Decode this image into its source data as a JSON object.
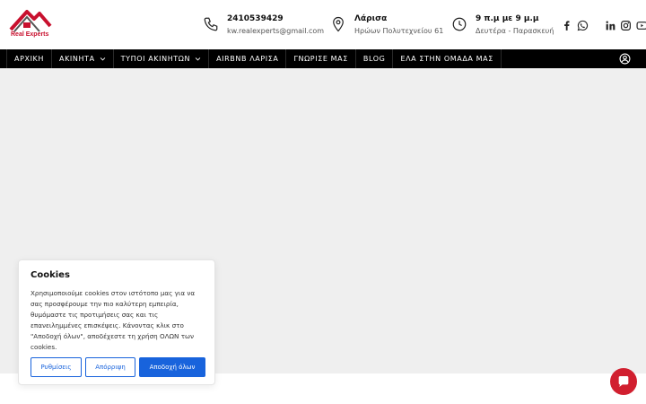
{
  "header": {
    "logo": {
      "brand_small": "keller williams",
      "brand_text": "Real Experts"
    },
    "phone": {
      "number": "2410539429",
      "email": "kw.realexperts@gmail.com"
    },
    "location": {
      "city": "Λάρισα",
      "address": "Ηρώων Πολυτεχνείου 61"
    },
    "hours": {
      "time": "9 π.μ με 9 μ.μ",
      "days": "Δευτέρα - Παρασκευή"
    },
    "social": [
      "facebook-icon",
      "whatsapp-icon",
      "linkedin-icon",
      "instagram-icon",
      "youtube-icon"
    ]
  },
  "nav": {
    "items": [
      {
        "label": "ΑΡΧΙΚΗ",
        "dropdown": false
      },
      {
        "label": "ΑΚΙΝΗΤΑ",
        "dropdown": true
      },
      {
        "label": "ΤΥΠΟΙ ΑΚΙΝΗΤΩΝ",
        "dropdown": true
      },
      {
        "label": "AIRBNB ΛΑΡΙΣΑ",
        "dropdown": false
      },
      {
        "label": "ΓΝΩΡΙΣΕ ΜΑΣ",
        "dropdown": false
      },
      {
        "label": "BLOG",
        "dropdown": false
      },
      {
        "label": "ΕΛΑ ΣΤΗΝ ΟΜΑΔΑ ΜΑΣ",
        "dropdown": false
      }
    ]
  },
  "cookie": {
    "title": "Cookies",
    "text": "Χρησιμοποιούμε cookies στον ιστότοπο μας για να σας προσφέρουμε την πιο καλύτερη εμπειρία, θυμόμαστε τις προτιμήσεις σας και τις επανειλημμένες επισκέψεις. Κάνοντας κλικ στο \"Αποδοχή όλων\", αποδέχεστε τη χρήση ΟΛΩΝ των cookies.",
    "settings_label": "Ρυθμίσεις",
    "reject_label": "Απόρριψη",
    "accept_label": "Αποδοχή όλων"
  },
  "colors": {
    "brand_red": "#c8102e",
    "button_blue": "#1863dc",
    "chat_red": "#d11f2f"
  }
}
